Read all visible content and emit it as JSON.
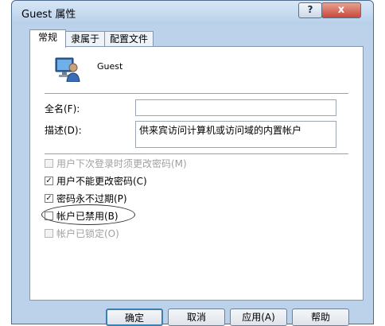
{
  "window": {
    "title": "Guest 属性",
    "help_label": "?",
    "close_label": "x"
  },
  "tabs": [
    {
      "label": "常规"
    },
    {
      "label": "隶属于"
    },
    {
      "label": "配置文件"
    }
  ],
  "user": {
    "name": "Guest",
    "icon": "user-icon"
  },
  "form": {
    "fullname_label": "全名(F):",
    "fullname_value": "",
    "description_label": "描述(D):",
    "description_value": "供来宾访问计算机或访问域的内置帐户"
  },
  "options": [
    {
      "label": "用户下次登录时须更改密码(M)",
      "checked": false,
      "disabled": true
    },
    {
      "label": "用户不能更改密码(C)",
      "checked": true,
      "disabled": false
    },
    {
      "label": "密码永不过期(P)",
      "checked": true,
      "disabled": false
    },
    {
      "label": "帐户已禁用(B)",
      "checked": false,
      "disabled": false
    },
    {
      "label": "帐户已锁定(O)",
      "checked": false,
      "disabled": true
    }
  ],
  "buttons": {
    "ok": "确定",
    "cancel": "取消",
    "apply": "应用(A)",
    "help": "帮助"
  }
}
